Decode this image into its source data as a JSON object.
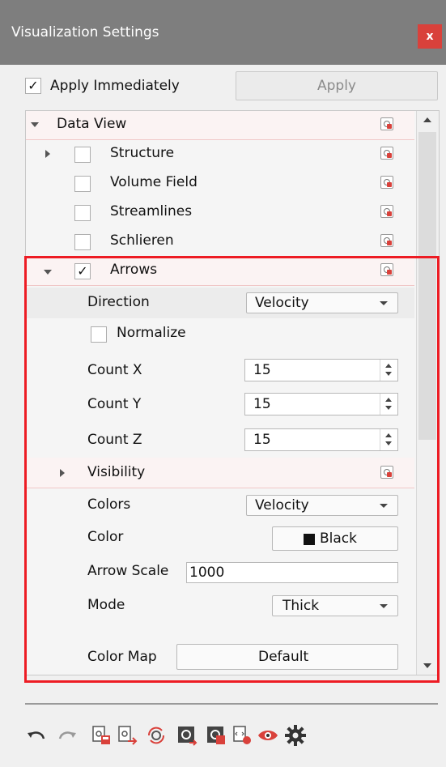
{
  "window": {
    "title": "Visualization Settings",
    "close_label": "x"
  },
  "apply": {
    "checkbox_label": "Apply Immediately",
    "checked": true,
    "button_label": "Apply"
  },
  "tree": {
    "root_label": "Data View",
    "items": [
      {
        "label": "Structure",
        "checked": false
      },
      {
        "label": "Volume Field",
        "checked": false
      },
      {
        "label": "Streamlines",
        "checked": false
      },
      {
        "label": "Schlieren",
        "checked": false
      },
      {
        "label": "Arrows",
        "checked": true
      }
    ],
    "arrows": {
      "direction_label": "Direction",
      "direction_value": "Velocity",
      "normalize_label": "Normalize",
      "normalize_checked": false,
      "count_x_label": "Count X",
      "count_x_value": "15",
      "count_y_label": "Count Y",
      "count_y_value": "15",
      "count_z_label": "Count Z",
      "count_z_value": "15",
      "visibility_label": "Visibility",
      "colors_label": "Colors",
      "colors_value": "Velocity",
      "color_label": "Color",
      "color_value": "Black",
      "color_swatch": "#111111",
      "arrow_scale_label": "Arrow Scale",
      "arrow_scale_value": "1000",
      "mode_label": "Mode",
      "mode_value": "Thick",
      "color_map_label": "Color Map",
      "color_map_value": "Default"
    }
  },
  "toolbar": {
    "icons": [
      "undo-icon",
      "redo-icon",
      "save-settings-icon",
      "export-settings-icon",
      "reload-icon",
      "apply-settings-icon",
      "reset-settings-icon",
      "copy-settings-icon",
      "visibility-icon",
      "settings-icon"
    ]
  },
  "accent": "#ed1c24"
}
